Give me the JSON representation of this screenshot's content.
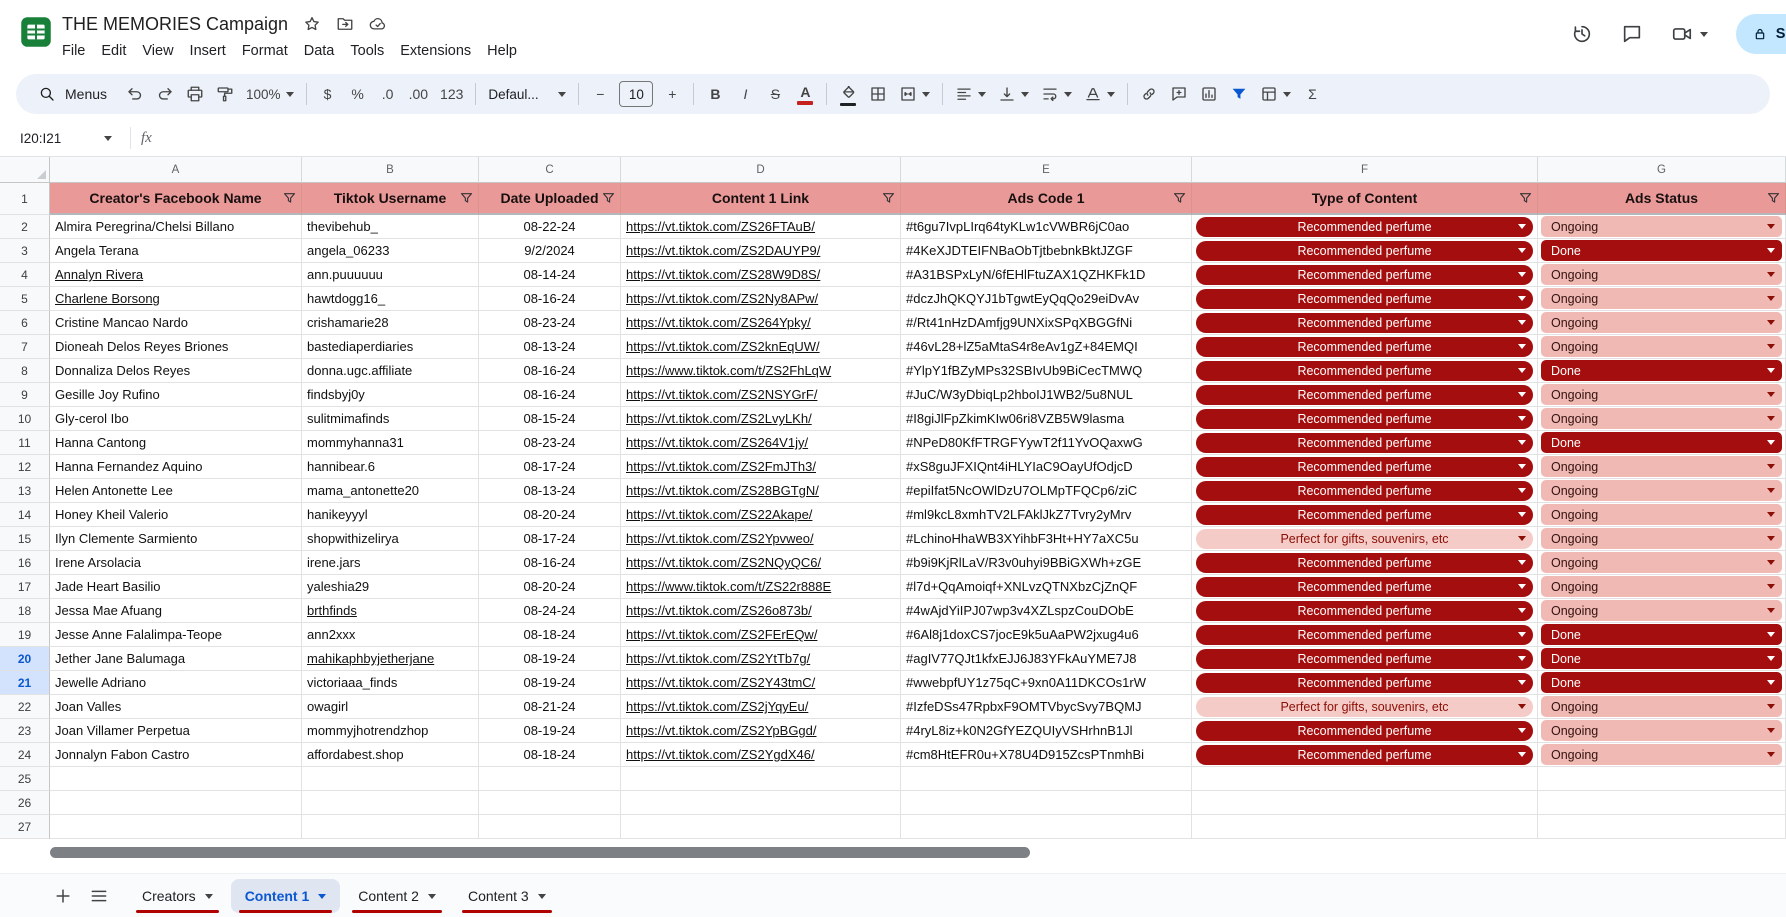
{
  "topbar": {
    "title": "THE MEMORIES Campaign",
    "menus": [
      "File",
      "Edit",
      "View",
      "Insert",
      "Format",
      "Data",
      "Tools",
      "Extensions",
      "Help"
    ],
    "share_label": "Share"
  },
  "toolbar": {
    "menus_label": "Menus",
    "zoom_value": "100%",
    "currency": "$",
    "percent": "%",
    "dec_decrease": ".0",
    "dec_increase": ".00",
    "number_format": "123",
    "font_name": "Defaul...",
    "minus": "−",
    "font_size": "10",
    "plus": "+",
    "bold": "B",
    "italic": "I",
    "strike": "S",
    "text_color": "A",
    "sigma": "Σ"
  },
  "formula_bar": {
    "name_box": "I20:I21",
    "fx": "fx"
  },
  "grid": {
    "columns": [
      "A",
      "B",
      "C",
      "D",
      "E",
      "F",
      "G"
    ],
    "header_row": {
      "row_num": "1",
      "cells": [
        "Creator's Facebook Name",
        "Tiktok Username",
        "Date Uploaded",
        "Content 1 Link",
        "Ads Code 1",
        "Type of Content",
        "Ads Status"
      ]
    },
    "rows": [
      {
        "n": "2",
        "name": "Almira Peregrina/Chelsi Billano",
        "user": "thevibehub_",
        "date": "08-22-24",
        "link": "https://vt.tiktok.com/ZS26FTAuB/",
        "code": "#t6gu7IvpLIrq64tyKLw1cVWBR6jC0ao",
        "type": "Recommended perfume",
        "type_variant": "dark",
        "status": "Ongoing",
        "status_variant": "ongoing"
      },
      {
        "n": "3",
        "name": "Angela Terana",
        "user": "angela_06233",
        "date": "9/2/2024",
        "link": "https://vt.tiktok.com/ZS2DAUYP9/",
        "code": "#4KeXJDTEIFNBaObTjtbebnkBktJZGF",
        "type": "Recommended perfume",
        "type_variant": "dark",
        "status": "Done",
        "status_variant": "done"
      },
      {
        "n": "4",
        "name": "Annalyn Rivera",
        "name_u": true,
        "user": "ann.puuuuuu",
        "date": "08-14-24",
        "link": "https://vt.tiktok.com/ZS28W9D8S/",
        "code": "#A31BSPxLyN/6fEHlFtuZAX1QZHKFk1D",
        "type": "Recommended perfume",
        "type_variant": "dark",
        "status": "Ongoing",
        "status_variant": "ongoing"
      },
      {
        "n": "5",
        "name": "Charlene Borsong",
        "name_u": true,
        "user": "hawtdogg16_",
        "date": "08-16-24",
        "link": "https://vt.tiktok.com/ZS2Ny8APw/",
        "code": "#dczJhQKQYJ1bTgwtEyQqQo29eiDvAv",
        "type": "Recommended perfume",
        "type_variant": "dark",
        "status": "Ongoing",
        "status_variant": "ongoing"
      },
      {
        "n": "6",
        "name": "Cristine Mancao Nardo",
        "user": "crishamarie28",
        "date": "08-23-24",
        "link": "https://vt.tiktok.com/ZS264Ypky/",
        "code": "#/Rt41nHzDAmfjg9UNXixSPqXBGGfNi",
        "type": "Recommended perfume",
        "type_variant": "dark",
        "status": "Ongoing",
        "status_variant": "ongoing"
      },
      {
        "n": "7",
        "name": "Dioneah Delos Reyes Briones",
        "user": "bastediaperdiaries",
        "date": "08-13-24",
        "link": "https://vt.tiktok.com/ZS2knEqUW/",
        "code": "#46vL28+lZ5aMtaS4r8eAv1gZ+84EMQI",
        "type": "Recommended perfume",
        "type_variant": "dark",
        "status": "Ongoing",
        "status_variant": "ongoing"
      },
      {
        "n": "8",
        "name": "Donnaliza Delos Reyes",
        "user": "donna.ugc.affiliate",
        "date": "08-16-24",
        "link": "https://www.tiktok.com/t/ZS2FhLqW",
        "code": "#YlpY1fBZyMPs32SBIvUb9BiCecTMWQ",
        "type": "Recommended perfume",
        "type_variant": "dark",
        "status": "Done",
        "status_variant": "done"
      },
      {
        "n": "9",
        "name": "Gesille Joy Rufino",
        "user": "findsbyj0y",
        "date": "08-16-24",
        "link": "https://vt.tiktok.com/ZS2NSYGrF/",
        "code": "#JuC/W3yDbiqLp2hboIJ1WB2/5u8NUL",
        "type": "Recommended perfume",
        "type_variant": "dark",
        "status": "Ongoing",
        "status_variant": "ongoing"
      },
      {
        "n": "10",
        "name": "Gly-cerol Ibo",
        "user": "sulitmimafinds",
        "date": "08-15-24",
        "link": "https://vt.tiktok.com/ZS2LvyLKh/",
        "code": "#I8giJlFpZkimKIw06ri8VZB5W9lasma",
        "type": "Recommended perfume",
        "type_variant": "dark",
        "status": "Ongoing",
        "status_variant": "ongoing"
      },
      {
        "n": "11",
        "name": "Hanna Cantong",
        "user": "mommyhanna31",
        "date": "08-23-24",
        "link": "https://vt.tiktok.com/ZS264V1jy/",
        "code": "#NPeD80KfFTRGFYywT2f11YvOQaxwG",
        "type": "Recommended perfume",
        "type_variant": "dark",
        "status": "Done",
        "status_variant": "done"
      },
      {
        "n": "12",
        "name": "Hanna Fernandez Aquino",
        "user": "hannibear.6",
        "date": "08-17-24",
        "link": "https://vt.tiktok.com/ZS2FmJTh3/",
        "code": "#xS8guJFXIQnt4iHLYIaC9OayUfOdjcD",
        "type": "Recommended perfume",
        "type_variant": "dark",
        "status": "Ongoing",
        "status_variant": "ongoing"
      },
      {
        "n": "13",
        "name": "Helen Antonette Lee",
        "user": "mama_antonette20",
        "date": "08-13-24",
        "link": "https://vt.tiktok.com/ZS28BGTgN/",
        "code": "#epiIfat5NcOWlDzU7OLMpTFQCp6/ziC",
        "type": "Recommended perfume",
        "type_variant": "dark",
        "status": "Ongoing",
        "status_variant": "ongoing"
      },
      {
        "n": "14",
        "name": "Honey Kheil Valerio",
        "user": "hanikeyyyl",
        "date": "08-20-24",
        "link": "https://vt.tiktok.com/ZS22Akape/",
        "code": "#ml9kcL8xmhTV2LFAklJkZ7Tvry2yMrv",
        "type": "Recommended perfume",
        "type_variant": "dark",
        "status": "Ongoing",
        "status_variant": "ongoing"
      },
      {
        "n": "15",
        "name": "Ilyn Clemente Sarmiento",
        "user": "shopwithizelirya",
        "date": "08-17-24",
        "link": "https://vt.tiktok.com/ZS2Ypvweo/",
        "code": "#LchinoHhaWB3XYihbF3Ht+HY7aXC5u",
        "type": "Perfect for gifts, souvenirs, etc",
        "type_variant": "light",
        "status": "Ongoing",
        "status_variant": "ongoing"
      },
      {
        "n": "16",
        "name": "Irene Arsolacia",
        "user": "irene.jars",
        "date": "08-16-24",
        "link": "https://vt.tiktok.com/ZS2NQyQC6/",
        "code": "#b9i9KjRlLaV/R3v0uhyi9BBiGXWh+zGE",
        "type": "Recommended perfume",
        "type_variant": "dark",
        "status": "Ongoing",
        "status_variant": "ongoing"
      },
      {
        "n": "17",
        "name": "Jade Heart Basilio",
        "user": "yaleshia29",
        "date": "08-20-24",
        "link": "https://www.tiktok.com/t/ZS22r888E",
        "code": "#l7d+QqAmoiqf+XNLvzQTNXbzCjZnQF",
        "type": "Recommended perfume",
        "type_variant": "dark",
        "status": "Ongoing",
        "status_variant": "ongoing"
      },
      {
        "n": "18",
        "name": "Jessa Mae Afuang",
        "user": "brthfinds",
        "user_u": true,
        "date": "08-24-24",
        "link": "https://vt.tiktok.com/ZS26o873b/",
        "code": "#4wAjdYiIPJ07wp3v4XZLspzCouDObE",
        "type": "Recommended perfume",
        "type_variant": "dark",
        "status": "Ongoing",
        "status_variant": "ongoing"
      },
      {
        "n": "19",
        "name": "Jesse Anne Falalimpa-Teope",
        "user": "ann2xxx",
        "date": "08-18-24",
        "link": "https://vt.tiktok.com/ZS2FErEQw/",
        "code": "#6Al8j1doxCS7jocE9k5uAaPW2jxug4u6",
        "type": "Recommended perfume",
        "type_variant": "dark",
        "status": "Done",
        "status_variant": "done"
      },
      {
        "n": "20",
        "name": "Jether Jane Balumaga",
        "user": "mahikaphbyjetherjane",
        "user_u": true,
        "date": "08-19-24",
        "link": "https://vt.tiktok.com/ZS2YtTb7g/",
        "code": "#agIV77QJt1kfxEJJ6J83YFkAuYME7J8",
        "type": "Recommended perfume",
        "type_variant": "dark",
        "status": "Done",
        "status_variant": "done",
        "selected": true
      },
      {
        "n": "21",
        "name": "Jewelle Adriano",
        "user": "victoriaaa_finds",
        "date": "08-19-24",
        "link": "https://vt.tiktok.com/ZS2Y43tmC/",
        "code": "#wwebpfUY1z75qC+9xn0A11DKCOs1rW",
        "type": "Recommended perfume",
        "type_variant": "dark",
        "status": "Done",
        "status_variant": "done",
        "selected": true
      },
      {
        "n": "22",
        "name": "Joan Valles",
        "user": "owagirl",
        "date": "08-21-24",
        "link": "https://vt.tiktok.com/ZS2jYqyEu/",
        "code": "#IzfeDSs47RpbxF9OMTVbycSvy7BQMJ",
        "type": "Perfect for gifts, souvenirs, etc",
        "type_variant": "light",
        "status": "Ongoing",
        "status_variant": "ongoing"
      },
      {
        "n": "23",
        "name": "Joan Villamer Perpetua",
        "user": "mommyjhotrendzhop",
        "date": "08-19-24",
        "link": "https://vt.tiktok.com/ZS2YpBGgd/",
        "code": "#4ryL8iz+k0N2GfYEZQUIyVSHrhnB1Jl",
        "type": "Recommended perfume",
        "type_variant": "dark",
        "status": "Ongoing",
        "status_variant": "ongoing"
      },
      {
        "n": "24",
        "name": "Jonnalyn Fabon Castro",
        "user": "affordabest.shop",
        "date": "08-18-24",
        "link": "https://vt.tiktok.com/ZS2YgdX46/",
        "code": "#cm8HtEFR0u+X78U4D915ZcsPTnmhBi",
        "type": "Recommended perfume",
        "type_variant": "dark",
        "status": "Ongoing",
        "status_variant": "ongoing"
      }
    ],
    "empty_rows": [
      "25",
      "26",
      "27"
    ]
  },
  "tabs": {
    "items": [
      {
        "label": "Creators",
        "active": false
      },
      {
        "label": "Content 1",
        "active": true
      },
      {
        "label": "Content 2",
        "active": false
      },
      {
        "label": "Content 3",
        "active": false
      }
    ]
  },
  "colors": {
    "header_bg": "#ea9999",
    "chip_dark_bg": "#a50e0e",
    "chip_light_bg": "#f5cbc7",
    "chip_light_text": "#8a0e05",
    "status_ongoing_bg": "#f1b9b4",
    "status_done_bg": "#a50e0e",
    "tab_color": "#b10202",
    "accent": "#0b57d0",
    "selection_highlight": "#d3e3fd"
  }
}
